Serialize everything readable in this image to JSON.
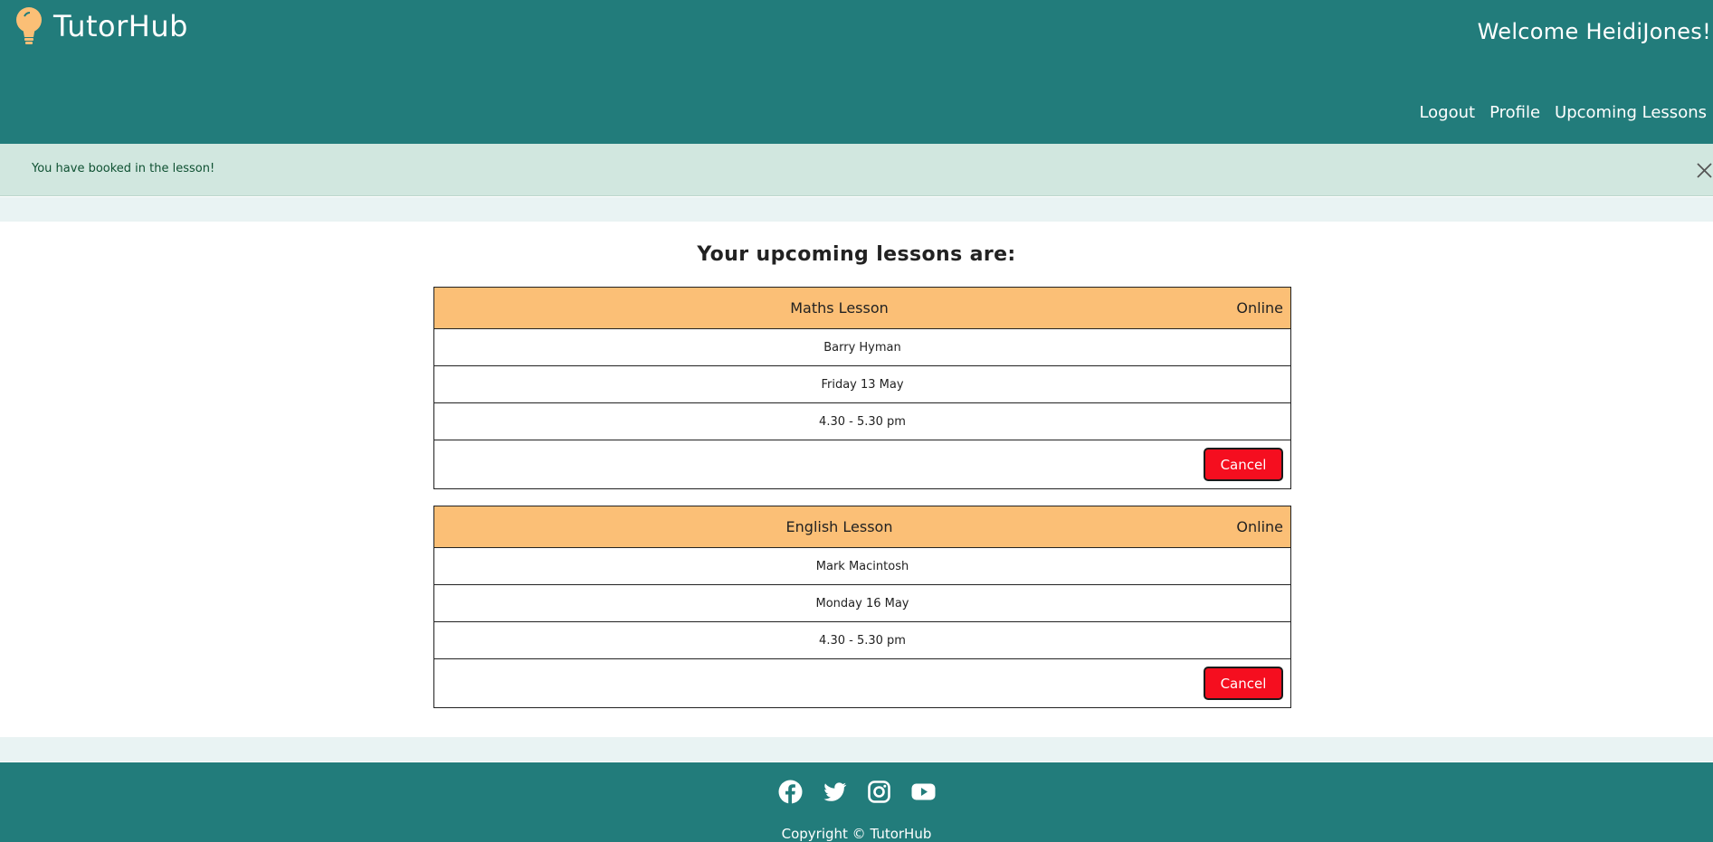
{
  "header": {
    "brand": "TutorHub",
    "welcome": "Welcome HeidiJones!",
    "nav": [
      "Logout",
      "Profile",
      "Upcoming Lessons"
    ]
  },
  "alert": {
    "message": "You have booked in the lesson!"
  },
  "main": {
    "title": "Your upcoming lessons are:",
    "lessons": [
      {
        "subject": "Maths Lesson",
        "mode": "Online",
        "tutor": "Barry Hyman",
        "date": "Friday 13 May",
        "time": "4.30 - 5.30 pm",
        "cancel_label": "Cancel"
      },
      {
        "subject": "English Lesson",
        "mode": "Online",
        "tutor": "Mark Macintosh",
        "date": "Monday 16 May",
        "time": "4.30 - 5.30 pm",
        "cancel_label": "Cancel"
      }
    ]
  },
  "footer": {
    "socials": [
      "facebook-icon",
      "twitter-icon",
      "instagram-icon",
      "youtube-icon"
    ],
    "copyright": "Copyright © TutorHub"
  },
  "colors": {
    "header_bg": "#227c7b",
    "alert_bg": "#d1e7df",
    "lesson_header_bg": "#fbbf76",
    "cancel_button": "#f50e1f",
    "band_bg": "#e9f3f3"
  }
}
